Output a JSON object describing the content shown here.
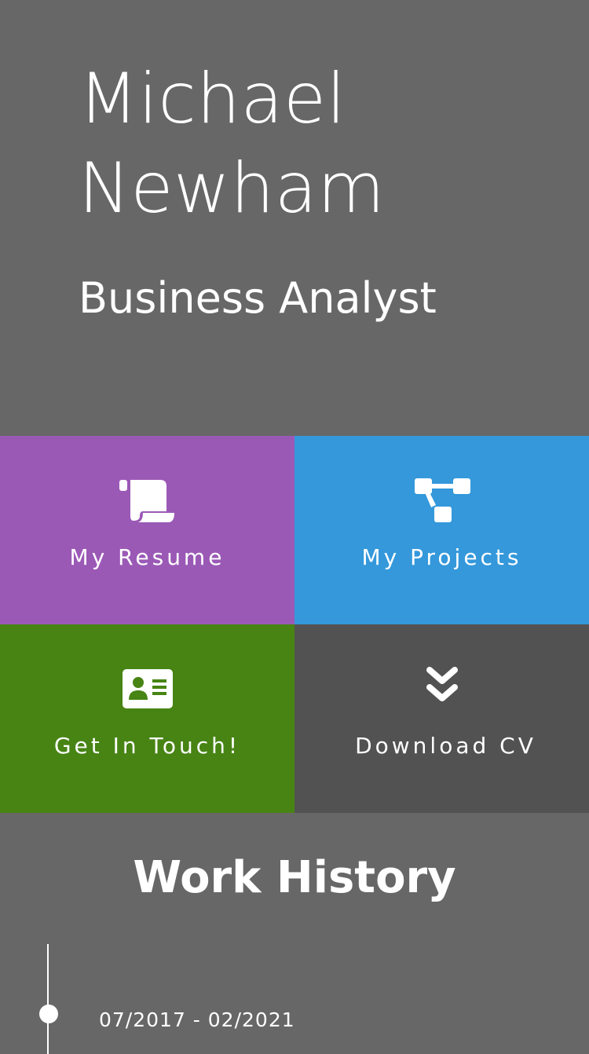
{
  "hero": {
    "first_name": "Michael",
    "last_name": "Newham",
    "role": "Business Analyst"
  },
  "tiles": [
    {
      "label": "My Resume",
      "icon": "scroll-icon",
      "color": "#9b59b6"
    },
    {
      "label": "My Projects",
      "icon": "project-diagram-icon",
      "color": "#3498db"
    },
    {
      "label": "Get In Touch!",
      "icon": "contact-card-icon",
      "color": "#478414"
    },
    {
      "label": "Download CV",
      "icon": "double-chevron-down-icon",
      "color": "#525252"
    }
  ],
  "work_history": {
    "title": "Work History",
    "entries": [
      {
        "dates": "07/2017 - 02/2021"
      }
    ]
  },
  "colors": {
    "background": "#676767",
    "text": "#ffffff"
  }
}
